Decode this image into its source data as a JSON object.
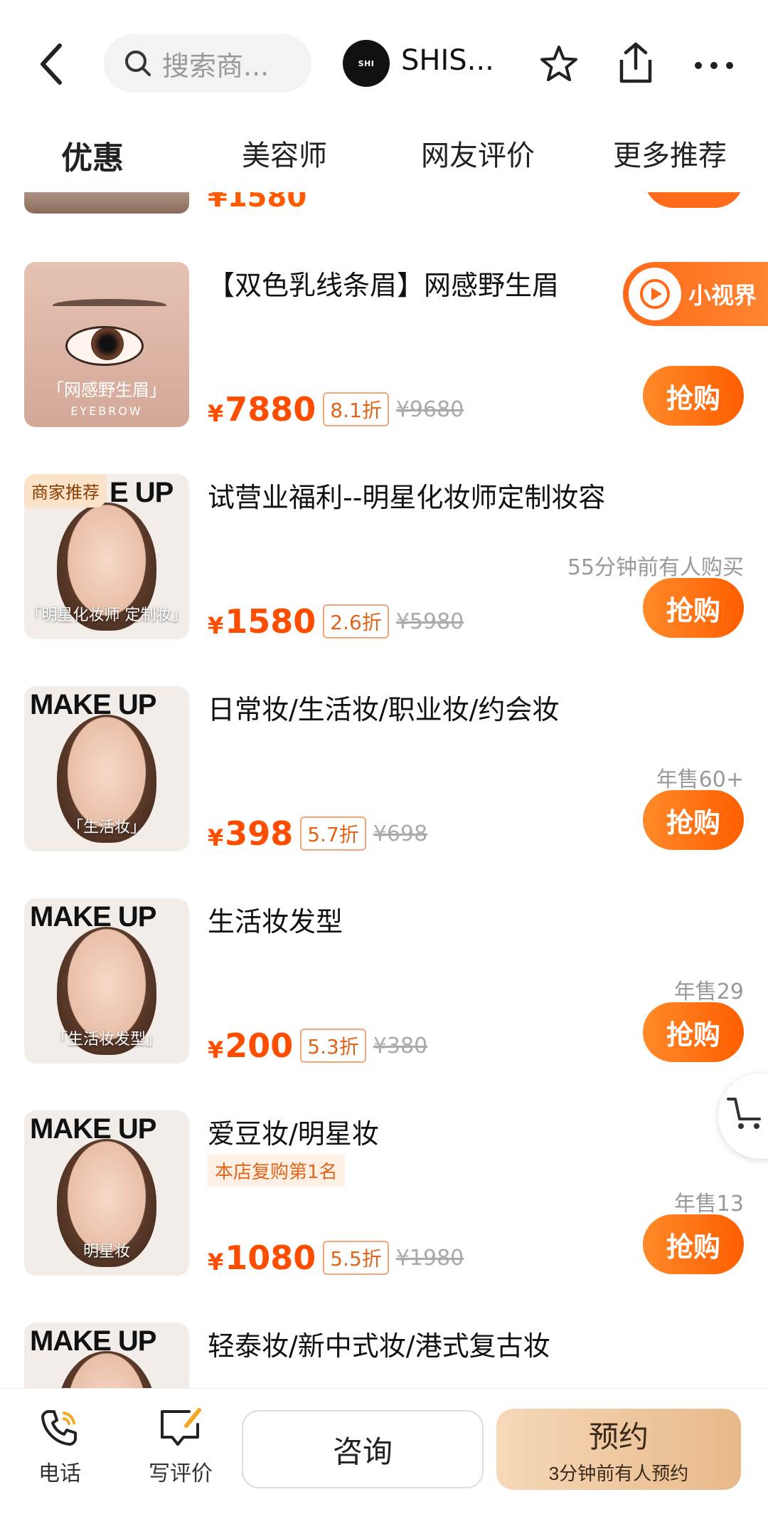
{
  "search": {
    "placeholder": "搜索商..."
  },
  "shop": {
    "name": "SHIS...",
    "logo_text": "SHI"
  },
  "tabs": [
    {
      "label": "优惠"
    },
    {
      "label": "美容师"
    },
    {
      "label": "网友评价"
    },
    {
      "label": "更多推荐"
    }
  ],
  "partial_item": {
    "price": "¥1580"
  },
  "float_badge": {
    "label": "小视界"
  },
  "items": [
    {
      "title": "【双色乳线条眉】网感野生眉",
      "thumb_caption": "「网感野生眉」",
      "thumb_sub": "EYEBROW",
      "price": "7880",
      "discount": "8.1折",
      "original": "¥9680",
      "buy": "抢购"
    },
    {
      "title": "试营业福利--明星化妆师定制妆容",
      "thumb_badge": "商家推荐",
      "thumb_headline": "E UP",
      "thumb_caption": "「明星化妆师 定制妆」",
      "sold": "55分钟前有人购买",
      "price": "1580",
      "discount": "2.6折",
      "original": "¥5980",
      "buy": "抢购"
    },
    {
      "title": "日常妆/生活妆/职业妆/约会妆",
      "thumb_headline": "MAKE UP",
      "thumb_caption": "「生活妆」",
      "sold": "年售60+",
      "price": "398",
      "discount": "5.7折",
      "original": "¥698",
      "buy": "抢购"
    },
    {
      "title": "生活妆发型",
      "thumb_headline": "MAKE UP",
      "thumb_caption": "「生活妆发型」",
      "sold": "年售29",
      "price": "200",
      "discount": "5.3折",
      "original": "¥380",
      "buy": "抢购"
    },
    {
      "title": "爱豆妆/明星妆",
      "tag": "本店复购第1名",
      "thumb_headline": "MAKE UP",
      "thumb_caption": "明星妆",
      "sold": "年售13",
      "price": "1080",
      "discount": "5.5折",
      "original": "¥1980",
      "buy": "抢购"
    },
    {
      "title": "轻泰妆/新中式妆/港式复古妆",
      "thumb_headline": "MAKE UP"
    }
  ],
  "currency": "¥",
  "bottom": {
    "phone": "电话",
    "review": "写评价",
    "consult": "咨询",
    "reserve": "预约",
    "reserve_sub": "3分钟前有人预约"
  }
}
